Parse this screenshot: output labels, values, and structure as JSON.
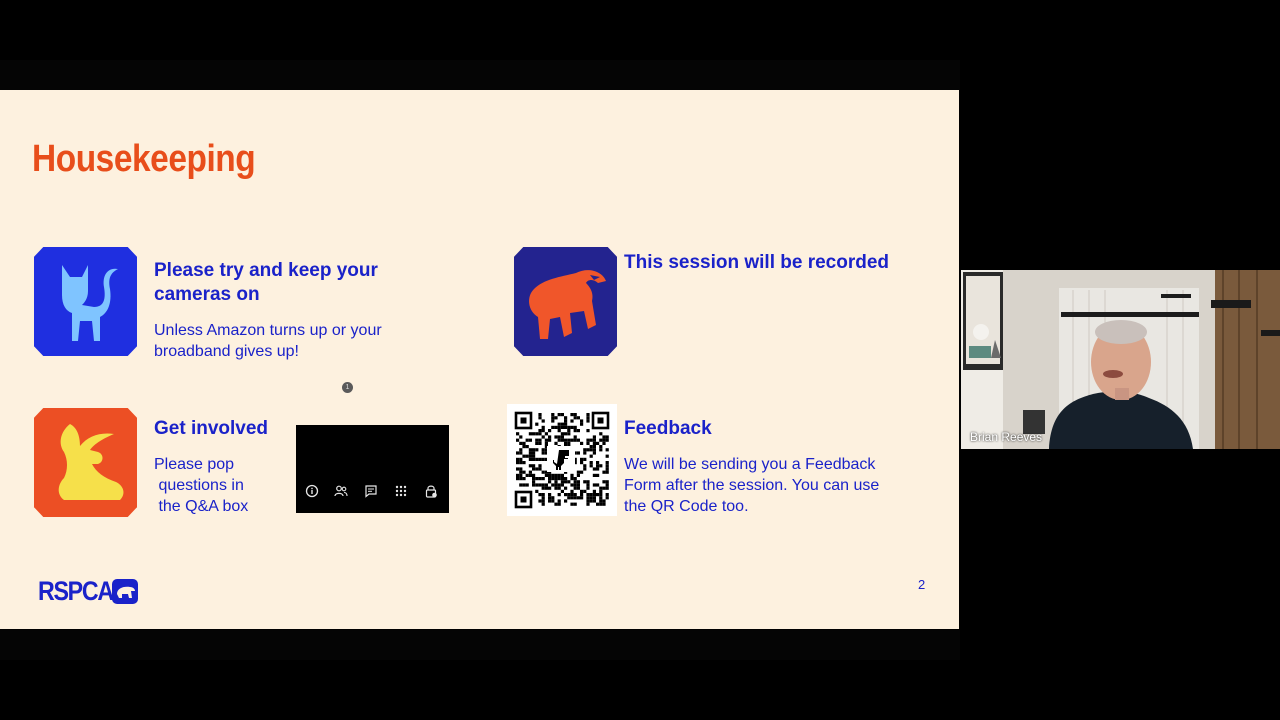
{
  "slide": {
    "title": "Housekeeping",
    "page_number": "2",
    "logo_text": "RSPCA",
    "sections": [
      {
        "heading_line1": "Please try and keep your",
        "heading_line2": "cameras on",
        "body_line1": "Unless Amazon turns up or your",
        "body_line2": "broadband gives up!",
        "badge_icon": "cat-icon",
        "badge_bg": "#1f2fe0",
        "badge_fg": "#7fc4ff"
      },
      {
        "heading_line1": "This session will be recorded",
        "badge_icon": "badger-icon",
        "badge_bg": "#23238f",
        "badge_fg": "#f0562a"
      },
      {
        "heading_line1": "Get involved",
        "body_line1": "Please pop",
        "body_line2": " questions in",
        "body_line3": " the Q&A box",
        "badge_icon": "hare-icon",
        "badge_bg": "#ec4f24",
        "badge_fg": "#f6e04a"
      },
      {
        "heading_line1": "Feedback",
        "body_line1": "We will be sending you a Feedback",
        "body_line2": "Form after the session. You can use",
        "body_line3": "the QR Code too.",
        "badge_icon": "qr-code"
      }
    ],
    "toolbar_icons": [
      "info-icon",
      "participants-icon",
      "chat-icon",
      "apps-icon",
      "lock-icon"
    ],
    "participants_count": "1"
  },
  "video": {
    "participant_name": "Brian Reeves"
  },
  "colors": {
    "accent_orange": "#e84e1b",
    "brand_blue": "#1a22c9",
    "slide_bg": "#fdf1df"
  }
}
